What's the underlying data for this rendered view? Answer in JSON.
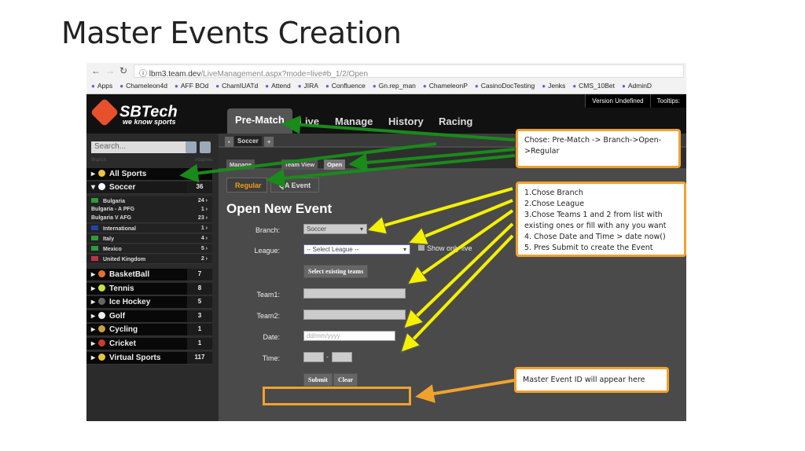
{
  "slide_title": "Master Events Creation",
  "browser": {
    "url_host": "lbm3.team.dev",
    "url_path": "/LiveManagement.aspx?mode=live#b_1/2/Open",
    "bookmarks": [
      "Apps",
      "Chameleon4d",
      "AFF BOd",
      "ChamIUATd",
      "Attend",
      "JIRA",
      "Confluence",
      "Gn.rep_man",
      "ChameleonP",
      "CasinoDocTesting",
      "Jenks",
      "CMS_10Bet",
      "AdminD"
    ]
  },
  "app": {
    "logo": "SBTech",
    "logo_tagline": "we know sports",
    "version": "Version Undefined",
    "tooltips": "Tooltips:",
    "tabs": [
      "Pre-Match",
      "Live",
      "Manage",
      "History",
      "Racing"
    ],
    "search_placeholder": "Search...",
    "branch_header": "Branch",
    "games_header": "#Games",
    "sidebar": {
      "all_sports": "All Sports",
      "soccer": {
        "label": "Soccer",
        "count": "36"
      },
      "sub": [
        {
          "label": "Bulgaria",
          "count": "24"
        },
        {
          "label": "Bulgaria - A PFG",
          "count": "1"
        },
        {
          "label": "Bulgaria V AFG",
          "count": "23"
        },
        {
          "label": "International",
          "count": "1"
        },
        {
          "label": "Italy",
          "count": "4"
        },
        {
          "label": "Mexico",
          "count": "5"
        },
        {
          "label": "United Kingdom",
          "count": "2"
        }
      ],
      "sports": [
        {
          "label": "BasketBall",
          "count": "7"
        },
        {
          "label": "Tennis",
          "count": "8"
        },
        {
          "label": "Ice Hockey",
          "count": "5"
        },
        {
          "label": "Golf",
          "count": "3"
        },
        {
          "label": "Cycling",
          "count": "1"
        },
        {
          "label": "Cricket",
          "count": "1"
        },
        {
          "label": "Virtual Sports",
          "count": "117"
        }
      ]
    },
    "branch_tab": "Soccer",
    "sub_tabs": [
      "Manage",
      "Team View",
      "Open"
    ],
    "event_tabs": [
      "Regular",
      "QA Event"
    ],
    "form": {
      "heading": "Open New Event",
      "branch_label": "Branch:",
      "branch_value": "Soccer",
      "league_label": "League:",
      "league_value": "-- Select League --",
      "show_only_live": "Show only live",
      "select_teams": "Select existing teams",
      "team1_label": "Team1:",
      "team2_label": "Team2:",
      "date_label": "Date:",
      "date_placeholder": "dd/mm/yyyy",
      "time_label": "Time:",
      "time_sep": "-",
      "submit": "Submit",
      "clear": "Clear"
    }
  },
  "callouts": {
    "nav": "Chose: Pre-Match -> Branch->Open->Regular",
    "steps": [
      "1.Chose Branch",
      "2.Chose League",
      "3.Chose Teams 1 and 2 from list with existing ones or fill with any you want",
      "4. Chose Date and Time > date now()",
      "5. Pres Submit to create the Event"
    ],
    "master_id": "Master Event ID will appear here"
  },
  "colors": {
    "green_arrow": "#1a8a1a",
    "yellow_arrow": "#f5f000",
    "orange": "#f0a22e",
    "accent_tab": "#f39c12"
  }
}
